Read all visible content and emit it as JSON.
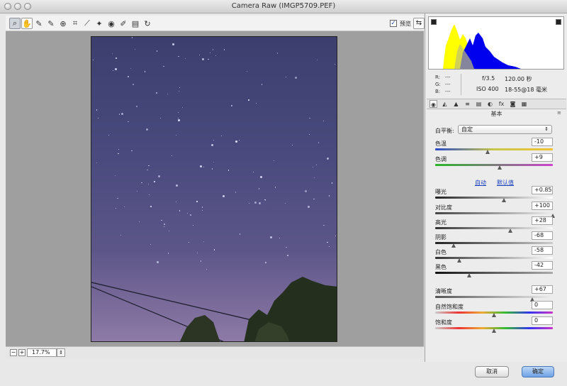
{
  "window": {
    "title": "Camera Raw (IMGP5709.PEF)"
  },
  "toolbar": {
    "tools": [
      {
        "name": "zoom-tool",
        "glyph": "⌕"
      },
      {
        "name": "hand-tool",
        "glyph": "✋"
      },
      {
        "name": "white-balance-tool",
        "glyph": "✎"
      },
      {
        "name": "color-sampler-tool",
        "glyph": "✎"
      },
      {
        "name": "targeted-adjustment-tool",
        "glyph": "⊕"
      },
      {
        "name": "crop-tool",
        "glyph": "⌗"
      },
      {
        "name": "straighten-tool",
        "glyph": "⟋"
      },
      {
        "name": "spot-removal-tool",
        "glyph": "✦"
      },
      {
        "name": "red-eye-tool",
        "glyph": "◉"
      },
      {
        "name": "adjustment-brush-tool",
        "glyph": "✐"
      },
      {
        "name": "graduated-filter-tool",
        "glyph": "▤"
      },
      {
        "name": "rotate-tool",
        "glyph": "↻"
      }
    ],
    "preview_label": "预览",
    "preview_checked": "✓",
    "fullscreen_icon": "⇆"
  },
  "status": {
    "zoom_value": "17.7%",
    "zoom_out": "−",
    "zoom_in": "+",
    "zoom_arrow": "⇕"
  },
  "info": {
    "r_label": "R:",
    "g_label": "G:",
    "b_label": "B:",
    "r_value": "---",
    "g_value": "---",
    "b_value": "---",
    "aperture": "f/3.5",
    "shutter": "120.00 秒",
    "iso": "ISO 400",
    "lens": "18-55@18 毫米"
  },
  "panel": {
    "tabs": [
      "◉",
      "◭",
      "▲",
      "≡",
      "▤",
      "◐",
      "fx",
      "◙",
      "▦"
    ],
    "title": "基本",
    "menu_icon": "≡",
    "white_balance_label": "白平衡:",
    "white_balance_value": "自定",
    "white_balance_arrow": "⇕",
    "auto_link": "自动",
    "default_link": "默认值",
    "sliders": [
      {
        "label": "色温",
        "value": "-10",
        "pos": 0.45
      },
      {
        "label": "色调",
        "value": "+9",
        "pos": 0.55
      },
      {
        "label": "曝光",
        "value": "+0.85",
        "pos": 0.59
      },
      {
        "label": "对比度",
        "value": "+100",
        "pos": 1.0
      },
      {
        "label": "高光",
        "value": "+28",
        "pos": 0.64
      },
      {
        "label": "阴影",
        "value": "-68",
        "pos": 0.16
      },
      {
        "label": "白色",
        "value": "-58",
        "pos": 0.21
      },
      {
        "label": "黑色",
        "value": "-42",
        "pos": 0.29
      },
      {
        "label": "清晰度",
        "value": "+67",
        "pos": 0.83
      },
      {
        "label": "自然饱和度",
        "value": "0",
        "pos": 0.5
      },
      {
        "label": "饱和度",
        "value": "0",
        "pos": 0.5
      }
    ]
  },
  "buttons": {
    "cancel": "取消",
    "ok": "确定"
  },
  "colors": {
    "accent": "#6fa3e6",
    "histogram_yellow": "#ffff00",
    "histogram_blue": "#0000ee"
  }
}
